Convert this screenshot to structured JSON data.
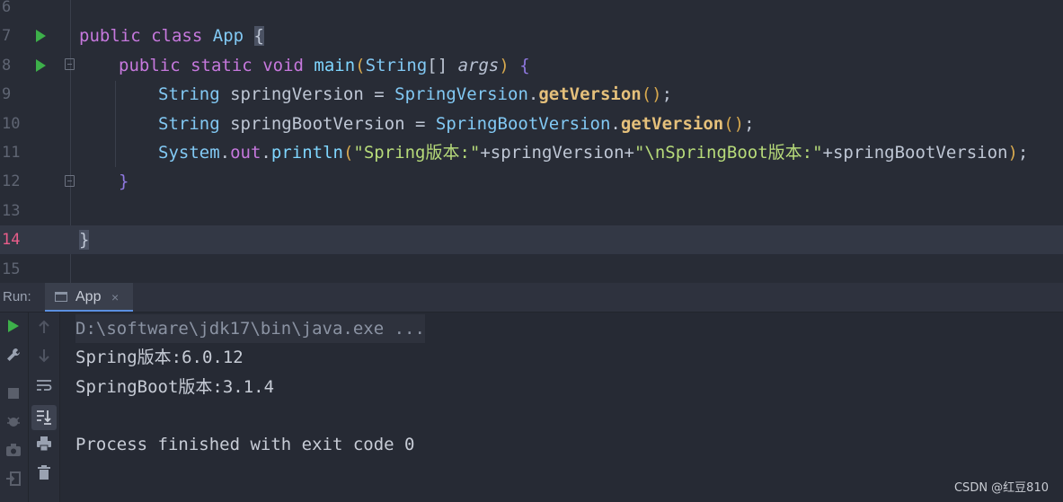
{
  "editor": {
    "line_numbers": [
      "6",
      "7",
      "8",
      "9",
      "10",
      "11",
      "12",
      "13",
      "14",
      "15"
    ],
    "code": {
      "l7": {
        "kw1": "public",
        "kw2": "class",
        "cls": "App",
        "brace": "{"
      },
      "l8": {
        "kw1": "public",
        "kw2": "static",
        "kw3": "void",
        "fn": "main",
        "open": "(",
        "type": "String",
        "arr": "[]",
        "param": "args",
        "close": ")",
        "brace": "{"
      },
      "l9": {
        "type": "String",
        "var": "springVersion",
        "eq": "=",
        "cls": "SpringVersion",
        "dot": ".",
        "method": "getVersion",
        "call": "()",
        "semi": ";"
      },
      "l10": {
        "type": "String",
        "var": "springBootVersion",
        "eq": "=",
        "cls": "SpringBootVersion",
        "dot": ".",
        "method": "getVersion",
        "call": "()",
        "semi": ";"
      },
      "l11": {
        "cls": "System",
        "dot1": ".",
        "field": "out",
        "dot2": ".",
        "fn": "println",
        "open": "(",
        "str1": "\"Spring版本:\"",
        "plus1": "+springVersion+",
        "str2": "\"\\nSpringBoot版本:\"",
        "plus2": "+springBootVersion",
        "close": ")",
        "semi": ";"
      },
      "l12": {
        "brace": "}"
      },
      "l14": {
        "brace": "}"
      }
    }
  },
  "run_panel": {
    "label": "Run:",
    "tab_label": "App",
    "tab_close": "×",
    "output": {
      "command": "D:\\software\\jdk17\\bin\\java.exe ...",
      "line1": "Spring版本:6.0.12",
      "line2": "SpringBoot版本:3.1.4",
      "line3": "Process finished with exit code 0"
    },
    "icons_left": [
      "run-icon",
      "wrench-icon",
      "stop-icon",
      "debug-icon",
      "camera-icon",
      "exit-icon"
    ],
    "icons_right": [
      "arrow-up-icon",
      "arrow-down-icon",
      "soft-wrap-icon",
      "scroll-to-end-icon",
      "print-icon",
      "trash-icon"
    ]
  },
  "colors": {
    "run_green": "#3db04a",
    "tab_underline": "#5b8fe0",
    "current_line_number": "#e85d8a"
  },
  "watermark": "CSDN @红豆810"
}
